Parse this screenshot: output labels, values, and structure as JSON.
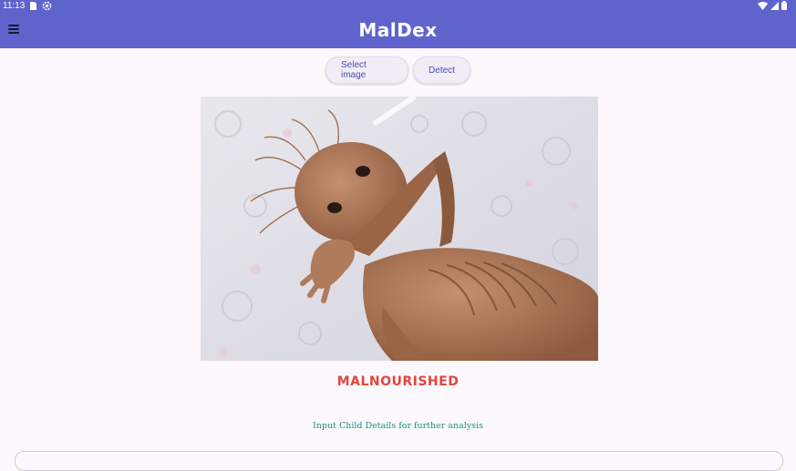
{
  "status_bar": {
    "time": "11:13"
  },
  "app_bar": {
    "title": "MalDex",
    "background": "#5f64cc"
  },
  "actions": {
    "select_image_label": "Select image",
    "detect_label": "Detect"
  },
  "result": {
    "label": "MALNOURISHED",
    "color": "#e0463e"
  },
  "hint": {
    "text": "Input Child Details for further analysis",
    "color": "#1d8f83"
  }
}
